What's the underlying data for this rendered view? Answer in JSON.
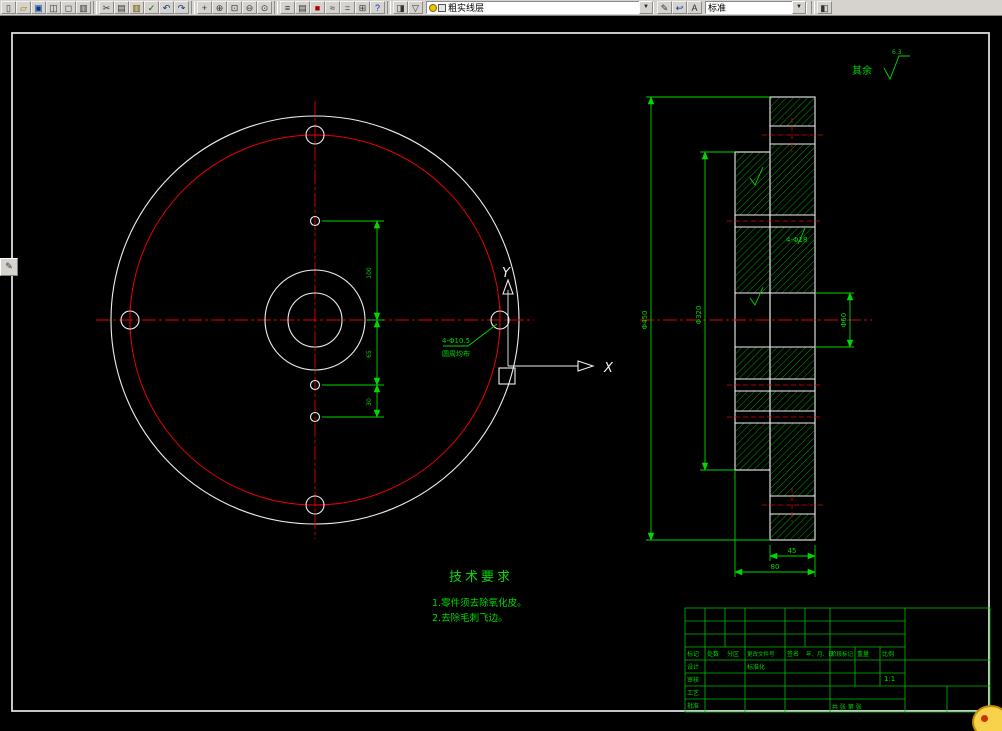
{
  "window": {
    "chrome_bg": "#d6d3ce",
    "canvas_bg": "#000000"
  },
  "colors": {
    "entity_white": "#efefef",
    "entity_red": "#e80000",
    "dimension_green": "#00d800",
    "titleblock_green": "#00c000"
  },
  "toolbar": {
    "dropdown_glyph": "▼",
    "dock_glyph": "✎",
    "layer_combo_value": "粗实线层",
    "style_combo_value": "标准",
    "g_file": [
      {
        "name": "new-icon",
        "glyph": "▯"
      },
      {
        "name": "open-icon",
        "glyph": "▱",
        "color": "#a07800"
      },
      {
        "name": "save-icon",
        "glyph": "▣",
        "color": "#003a8c"
      },
      {
        "name": "plot-icon",
        "glyph": "◫"
      },
      {
        "name": "plot-preview-icon",
        "glyph": "◻"
      },
      {
        "name": "publish-icon",
        "glyph": "▥"
      }
    ],
    "g_edit": [
      {
        "name": "cut-icon",
        "glyph": "✂"
      },
      {
        "name": "copy-icon",
        "glyph": "▤"
      },
      {
        "name": "paste-icon",
        "glyph": "▥",
        "color": "#6a5200"
      },
      {
        "name": "match-properties-icon",
        "glyph": "✓",
        "color": "#006600"
      },
      {
        "name": "undo-icon",
        "glyph": "↶",
        "color": "#002f8c"
      },
      {
        "name": "redo-icon",
        "glyph": "↷",
        "color": "#002f8c"
      }
    ],
    "g_zoom": [
      {
        "name": "pan-icon",
        "glyph": "+"
      },
      {
        "name": "zoom-realtime-icon",
        "glyph": "⊕"
      },
      {
        "name": "zoom-window-icon",
        "glyph": "⊡"
      },
      {
        "name": "zoom-previous-icon",
        "glyph": "⊖"
      },
      {
        "name": "zoom-extents-icon",
        "glyph": "⊙"
      }
    ],
    "g_mid": [
      {
        "name": "layers-icon",
        "glyph": "≡"
      },
      {
        "name": "layer-properties-icon",
        "glyph": "▤"
      },
      {
        "name": "color-control-icon",
        "glyph": "■",
        "color": "#b00000"
      },
      {
        "name": "linetype-icon",
        "glyph": "≈"
      },
      {
        "name": "lineweight-icon",
        "glyph": "="
      },
      {
        "name": "table-icon",
        "glyph": "⊞"
      },
      {
        "name": "help-icon",
        "glyph": "?",
        "color": "#0033cc"
      }
    ],
    "g_layer_tools": [
      {
        "name": "layer-states-icon",
        "glyph": "◨"
      },
      {
        "name": "layer-filter-icon",
        "glyph": "▽"
      }
    ],
    "g_layer2": [
      {
        "name": "make-object-layer-icon",
        "glyph": "✎"
      },
      {
        "name": "layer-previous-icon",
        "glyph": "↩",
        "color": "#002f8c"
      },
      {
        "name": "text-style-icon",
        "glyph": "A"
      }
    ],
    "g_right": [
      {
        "name": "properties-palette-icon",
        "glyph": "◧"
      }
    ]
  },
  "drawing": {
    "ucs": {
      "x_label": "X",
      "y_label": "Y"
    },
    "surface": {
      "prefix": "其余",
      "value": "6.3"
    },
    "tech": {
      "title": "技术要求",
      "item1": "1.零件须去除氧化皮。",
      "item2": "2.去除毛刺飞边。"
    },
    "dims": {
      "front_chain_1": "100",
      "front_chain_2": "65",
      "front_chain_3": "30",
      "front_note1": "4-Φ10.5",
      "front_note2": "圆周均布",
      "section_od": "Φ450",
      "section_hub": "Φ320",
      "section_bore": "Φ60",
      "section_note": "4-Φ18",
      "bottom_thickness": "45",
      "bottom_total": "80"
    }
  },
  "title_block": {
    "mark": "标记",
    "count": "处数",
    "zone": "分区",
    "change_no": "更改文件号",
    "sign": "签名",
    "date": "年、月、日",
    "design": "设计",
    "standard": "标准化",
    "check": "审核",
    "process": "工艺",
    "approve": "批准",
    "stage": "阶段标记",
    "weight": "重量",
    "scale": "比例",
    "scale_value": "1:1",
    "sheets": "共 张 第 张"
  }
}
